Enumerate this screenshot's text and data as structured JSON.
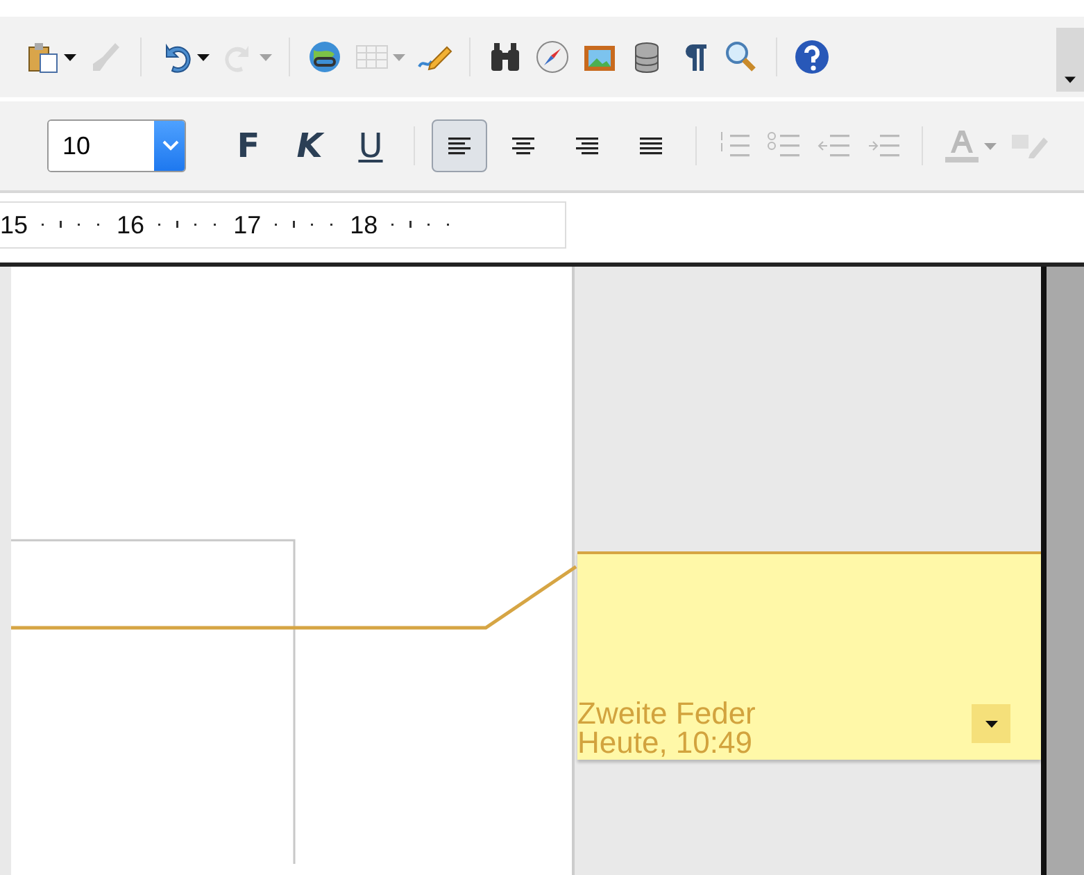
{
  "standard_toolbar": {
    "items": [
      {
        "kind": "paste",
        "dropdown": true,
        "disabled": false
      },
      {
        "kind": "brush",
        "dropdown": false,
        "disabled": true
      },
      {
        "kind": "separator"
      },
      {
        "kind": "undo",
        "dropdown": true,
        "disabled": false
      },
      {
        "kind": "redo",
        "dropdown": true,
        "disabled": true
      },
      {
        "kind": "separator"
      },
      {
        "kind": "globe",
        "dropdown": false,
        "disabled": false
      },
      {
        "kind": "table",
        "dropdown": true,
        "disabled": true
      },
      {
        "kind": "pencil",
        "dropdown": false,
        "disabled": false
      },
      {
        "kind": "separator"
      },
      {
        "kind": "binoculars",
        "dropdown": false,
        "disabled": false
      },
      {
        "kind": "compass",
        "dropdown": false,
        "disabled": false
      },
      {
        "kind": "picture",
        "dropdown": false,
        "disabled": false
      },
      {
        "kind": "database",
        "dropdown": false,
        "disabled": false
      },
      {
        "kind": "pilcrow",
        "dropdown": false,
        "disabled": false
      },
      {
        "kind": "magnifier",
        "dropdown": false,
        "disabled": false
      },
      {
        "kind": "separator"
      },
      {
        "kind": "help",
        "dropdown": false,
        "disabled": false
      }
    ]
  },
  "formatting_toolbar": {
    "font_size": "10",
    "styles": [
      {
        "label": "F",
        "kind": "bold"
      },
      {
        "label": "K",
        "kind": "italic"
      },
      {
        "label": "U",
        "kind": "underline"
      }
    ],
    "alignment": [
      {
        "kind": "left",
        "selected": true
      },
      {
        "kind": "center",
        "selected": false
      },
      {
        "kind": "right",
        "selected": false
      },
      {
        "kind": "justify",
        "selected": false
      }
    ],
    "lists": [
      {
        "kind": "numbered",
        "disabled": true
      },
      {
        "kind": "bulleted",
        "disabled": true
      },
      {
        "kind": "outdent",
        "disabled": true
      },
      {
        "kind": "indent",
        "disabled": true
      }
    ],
    "font_color": {
      "disabled": true
    },
    "highlight": {
      "disabled": true
    }
  },
  "ruler": {
    "marks": [
      "15",
      "16",
      "17",
      "18"
    ]
  },
  "comment": {
    "author": "Zweite Feder",
    "date": "Heute, 10:49"
  }
}
